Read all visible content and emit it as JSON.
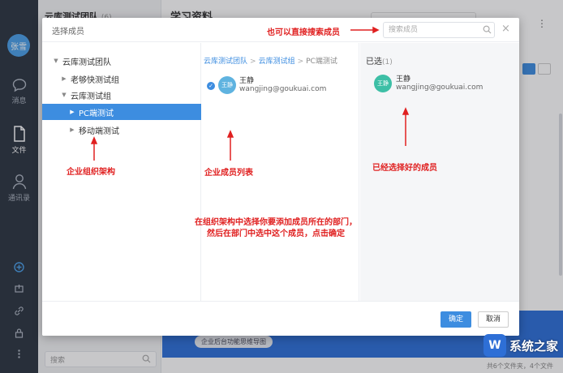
{
  "app": {
    "user_avatar": "张雪",
    "rail": {
      "messages": "消息",
      "files": "文件",
      "contacts": "通讯录"
    }
  },
  "sidebar": {
    "team_title": "云库测试团队",
    "team_count": "(6)",
    "search_placeholder": "搜索"
  },
  "main": {
    "title": "学习资料",
    "banner_chip": "企业后台功能思维导图",
    "footer_note": "共6个文件夹，4个文件"
  },
  "modal": {
    "title": "选择成员",
    "search_placeholder": "搜索成员",
    "tree": [
      {
        "label": "云库测试团队"
      },
      {
        "label": "老够快测试组"
      },
      {
        "label": "云库测试组"
      },
      {
        "label": "PC端测试"
      },
      {
        "label": "移动端测试"
      }
    ],
    "breadcrumb": [
      "云库测试团队",
      "云库测试组",
      "PC端测试"
    ],
    "members": [
      {
        "avatar": "王静",
        "name": "王静",
        "email": "wangjing@goukuai.com",
        "checked": true
      }
    ],
    "selected_label": "已选",
    "selected_count": "(1)",
    "selected": [
      {
        "avatar": "王静",
        "name": "王静",
        "email": "wangjing@goukuai.com"
      }
    ],
    "ok_label": "确定",
    "cancel_label": "取消"
  },
  "annotations": {
    "search_hint": "也可以直接搜索成员",
    "org_structure": "企业组织架构",
    "member_list": "企业成员列表",
    "selected_members": "已经选择好的成员",
    "instructions": "在组织架构中选择你要添加成员所在的部门，然后在部门中选中这个成员，点击确定"
  },
  "colors": {
    "accent": "#3d8de0",
    "annotation": "#e02020",
    "rail": "#2b3441"
  },
  "watermark": {
    "logo": "W",
    "text": "系统之家"
  }
}
